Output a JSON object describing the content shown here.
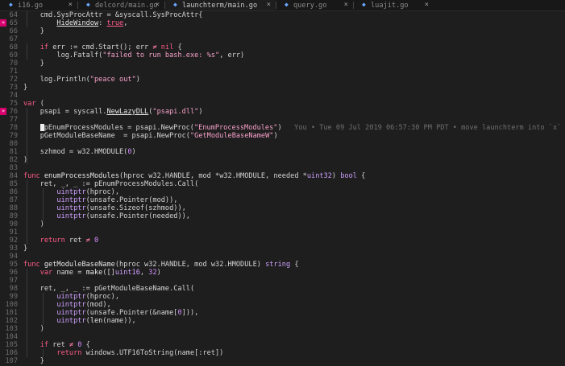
{
  "tabs": [
    {
      "label": "i16.go",
      "active": false
    },
    {
      "label": "delcord/main.go",
      "active": false
    },
    {
      "label": "launchterm/main.go",
      "active": true
    },
    {
      "label": "query.go",
      "active": false
    },
    {
      "label": "luajit.go",
      "active": false
    }
  ],
  "blame": "You • Tue 09 Jul 2019 06:57:30 PM PDT • move launchterm into `x`",
  "lines": [
    {
      "n": "64",
      "t": [
        [
          "id",
          "    cmd.SysProcAttr = &syscall.SysProcAttr{"
        ]
      ]
    },
    {
      "n": "65",
      "t": [
        [
          "id",
          "        "
        ],
        [
          "fn ul",
          "HideWindow"
        ],
        [
          "id",
          ": "
        ],
        [
          "kw ul",
          "true"
        ],
        [
          "id",
          ","
        ]
      ]
    },
    {
      "n": "66",
      "t": [
        [
          "id",
          "    }"
        ]
      ]
    },
    {
      "n": "67",
      "t": [
        [
          "id",
          ""
        ]
      ]
    },
    {
      "n": "68",
      "t": [
        [
          "kw",
          "    if "
        ],
        [
          "id",
          "err := cmd.Start(); err "
        ],
        [
          "op",
          "≠ "
        ],
        [
          "kw",
          "nil "
        ],
        [
          "id",
          "{"
        ]
      ]
    },
    {
      "n": "69",
      "t": [
        [
          "id",
          "        log.Fatalf("
        ],
        [
          "str",
          "\"failed to run bash.exe: %s\""
        ],
        [
          "id",
          ", err)"
        ]
      ]
    },
    {
      "n": "70",
      "t": [
        [
          "id",
          "    }"
        ]
      ]
    },
    {
      "n": "71",
      "t": [
        [
          "id",
          ""
        ]
      ]
    },
    {
      "n": "72",
      "t": [
        [
          "id",
          "    log.Println("
        ],
        [
          "str",
          "\"peace out\""
        ],
        [
          "id",
          ")"
        ]
      ]
    },
    {
      "n": "73",
      "t": [
        [
          "id",
          "}"
        ]
      ]
    },
    {
      "n": "74",
      "t": [
        [
          "id",
          ""
        ]
      ]
    },
    {
      "n": "75",
      "t": [
        [
          "kw",
          "var "
        ],
        [
          "id",
          "("
        ]
      ]
    },
    {
      "n": "76",
      "t": [
        [
          "id",
          "    psapi = syscall."
        ],
        [
          "fn ul",
          "NewLazyDLL"
        ],
        [
          "id",
          "("
        ],
        [
          "str",
          "\"psapi.dll\""
        ],
        [
          "id",
          ")"
        ]
      ]
    },
    {
      "n": "77",
      "t": [
        [
          "id",
          ""
        ]
      ]
    },
    {
      "n": "78",
      "t": [
        [
          "cursor",
          ""
        ],
        [
          "id",
          "pEnumProcessModules = psapi.NewProc("
        ],
        [
          "str",
          "\"EnumProcessModules\""
        ],
        [
          "id",
          ")"
        ]
      ],
      "blame": true
    },
    {
      "n": "79",
      "t": [
        [
          "id",
          "    pGetModuleBaseName  = psapi.NewProc("
        ],
        [
          "str",
          "\"GetModuleBaseNameW\""
        ],
        [
          "id",
          ")"
        ]
      ]
    },
    {
      "n": "80",
      "t": [
        [
          "id",
          ""
        ]
      ]
    },
    {
      "n": "81",
      "t": [
        [
          "id",
          "    szhmod = w32.HMODULE("
        ],
        [
          "num",
          "0"
        ],
        [
          "id",
          ")"
        ]
      ]
    },
    {
      "n": "82",
      "t": [
        [
          "id",
          ")"
        ]
      ]
    },
    {
      "n": "83",
      "t": [
        [
          "id",
          ""
        ]
      ]
    },
    {
      "n": "84",
      "t": [
        [
          "kw",
          "func "
        ],
        [
          "fn",
          "enumProcessModules"
        ],
        [
          "id",
          "(hproc w32.HANDLE, mod *w32.HMODULE, needed *"
        ],
        [
          "typ",
          "uint32"
        ],
        [
          "id",
          ") "
        ],
        [
          "typ",
          "bool"
        ],
        [
          "id",
          " {"
        ]
      ]
    },
    {
      "n": "85",
      "t": [
        [
          "id",
          "    ret, _, _ := pEnumProcessModules.Call("
        ]
      ]
    },
    {
      "n": "86",
      "t": [
        [
          "id",
          "        "
        ],
        [
          "typ",
          "uintptr"
        ],
        [
          "id",
          "(hproc),"
        ]
      ]
    },
    {
      "n": "87",
      "t": [
        [
          "id",
          "        "
        ],
        [
          "typ",
          "uintptr"
        ],
        [
          "id",
          "(unsafe.Pointer(mod)),"
        ]
      ]
    },
    {
      "n": "88",
      "t": [
        [
          "id",
          "        "
        ],
        [
          "typ",
          "uintptr"
        ],
        [
          "id",
          "(unsafe.Sizeof(szhmod)),"
        ]
      ]
    },
    {
      "n": "89",
      "t": [
        [
          "id",
          "        "
        ],
        [
          "typ",
          "uintptr"
        ],
        [
          "id",
          "(unsafe.Pointer(needed)),"
        ]
      ]
    },
    {
      "n": "90",
      "t": [
        [
          "id",
          "    )"
        ]
      ]
    },
    {
      "n": "91",
      "t": [
        [
          "id",
          ""
        ]
      ]
    },
    {
      "n": "92",
      "t": [
        [
          "kw",
          "    return "
        ],
        [
          "id",
          "ret "
        ],
        [
          "op",
          "≠ "
        ],
        [
          "num",
          "0"
        ]
      ]
    },
    {
      "n": "93",
      "t": [
        [
          "id",
          "}"
        ]
      ]
    },
    {
      "n": "94",
      "t": [
        [
          "id",
          ""
        ]
      ]
    },
    {
      "n": "95",
      "t": [
        [
          "kw",
          "func "
        ],
        [
          "fn",
          "getModuleBaseName"
        ],
        [
          "id",
          "(hproc w32.HANDLE, mod w32.HMODULE) "
        ],
        [
          "typ",
          "string"
        ],
        [
          "id",
          " {"
        ]
      ]
    },
    {
      "n": "96",
      "t": [
        [
          "kw",
          "    var "
        ],
        [
          "id",
          "name = "
        ],
        [
          "fn",
          "make"
        ],
        [
          "id",
          "([]"
        ],
        [
          "typ",
          "uint16"
        ],
        [
          "id",
          ", "
        ],
        [
          "num",
          "32"
        ],
        [
          "id",
          ")"
        ]
      ]
    },
    {
      "n": "97",
      "t": [
        [
          "id",
          ""
        ]
      ]
    },
    {
      "n": "98",
      "t": [
        [
          "id",
          "    ret, _, _ := pGetModuleBaseName.Call("
        ]
      ]
    },
    {
      "n": "99",
      "t": [
        [
          "id",
          "        "
        ],
        [
          "typ",
          "uintptr"
        ],
        [
          "id",
          "(hproc),"
        ]
      ]
    },
    {
      "n": "100",
      "t": [
        [
          "id",
          "        "
        ],
        [
          "typ",
          "uintptr"
        ],
        [
          "id",
          "(mod),"
        ]
      ]
    },
    {
      "n": "101",
      "t": [
        [
          "id",
          "        "
        ],
        [
          "typ",
          "uintptr"
        ],
        [
          "id",
          "(unsafe.Pointer(&name["
        ],
        [
          "num",
          "0"
        ],
        [
          "id",
          "])),"
        ]
      ]
    },
    {
      "n": "102",
      "t": [
        [
          "id",
          "        "
        ],
        [
          "typ",
          "uintptr"
        ],
        [
          "id",
          "("
        ],
        [
          "fn",
          "len"
        ],
        [
          "id",
          "(name)),"
        ]
      ]
    },
    {
      "n": "103",
      "t": [
        [
          "id",
          "    )"
        ]
      ]
    },
    {
      "n": "104",
      "t": [
        [
          "id",
          ""
        ]
      ]
    },
    {
      "n": "105",
      "t": [
        [
          "kw",
          "    if "
        ],
        [
          "id",
          "ret "
        ],
        [
          "op",
          "≠ "
        ],
        [
          "num",
          "0"
        ],
        [
          "id",
          " {"
        ]
      ]
    },
    {
      "n": "106",
      "t": [
        [
          "kw",
          "        return "
        ],
        [
          "id",
          "windows.UTF16ToString(name[:ret])"
        ]
      ]
    },
    {
      "n": "107",
      "t": [
        [
          "id",
          "    }"
        ]
      ]
    }
  ],
  "markers": [
    {
      "line": "65",
      "icon": "diff-marker-icon",
      "glyph": "»"
    },
    {
      "line": "76",
      "icon": "diff-marker-icon",
      "glyph": "»"
    }
  ],
  "colors": {
    "marker": "#d7006e",
    "keyword": "#ff5c8a",
    "string": "#f5a0c8",
    "type": "#cfa0ff"
  }
}
